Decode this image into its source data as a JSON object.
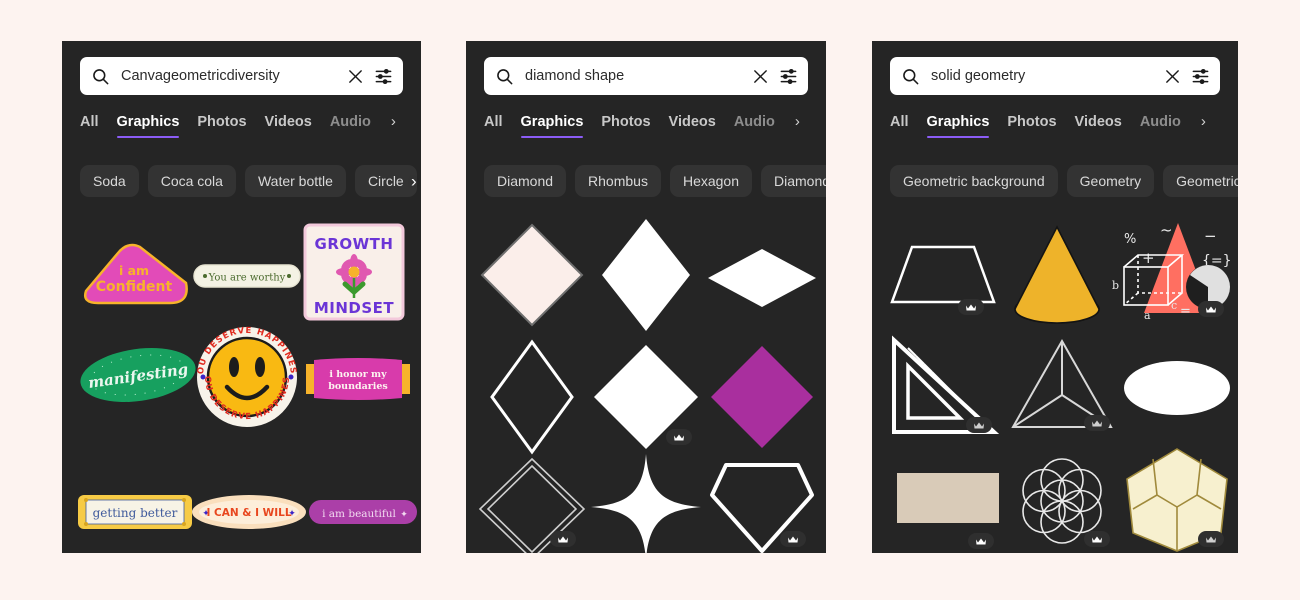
{
  "page": {
    "background_color": "#fdf3f0",
    "panel_background": "#252525",
    "accent_color": "#8b5cf6",
    "panel_count": 3
  },
  "icons": {
    "search": "search-icon",
    "clear": "close-icon",
    "filter": "filter-sliders-icon",
    "chevron_right": "chevron-right-icon",
    "crown": "crown-icon"
  },
  "tabs": [
    {
      "label": "All",
      "active": false,
      "faded": false
    },
    {
      "label": "Graphics",
      "active": true,
      "faded": false
    },
    {
      "label": "Photos",
      "active": false,
      "faded": false
    },
    {
      "label": "Videos",
      "active": false,
      "faded": false
    },
    {
      "label": "Audio",
      "active": false,
      "faded": true
    }
  ],
  "tab_overflow_arrow": "›",
  "panels": [
    {
      "id": "panel-1",
      "search": {
        "value": "Canvageometricdiversity",
        "placeholder": "Search"
      },
      "chips": [
        "Soda",
        "Coca cola",
        "Water bottle",
        "Circle"
      ],
      "chip_overflow_arrow": "›",
      "results_kind": "stickers",
      "items": [
        {
          "name": "i-am-confident-sticker",
          "text": "i am\nConfident",
          "shape": "wedge",
          "fill": "#e24bb8",
          "text_color": "#f7b32b",
          "pro": false
        },
        {
          "name": "you-are-worthy-sticker",
          "text": "You are worthy",
          "shape": "pill",
          "fill": "#f4f2e4",
          "text_color": "#4b6b2e",
          "pro": false
        },
        {
          "name": "growth-mindset-sticker",
          "text": "GROWTH\nMINDSET",
          "shape": "stamp",
          "fill": "#f9efe9",
          "text_color": "#6b35d6",
          "pro": false
        },
        {
          "name": "manifesting-sticker",
          "text": "manifesting",
          "shape": "ellipse",
          "fill": "#17a05f",
          "text_color": "#eaf7ef",
          "pro": false
        },
        {
          "name": "you-deserve-happiness-sticker",
          "text": "YOU DESERVE HAPPINESS",
          "shape": "smiley-badge",
          "fill": "#f9b912",
          "text_color": "#e02b20",
          "pro": false
        },
        {
          "name": "i-honor-my-boundaries-sticker",
          "text": "i honor my\nboundaries",
          "shape": "ticket",
          "fill": "#d83bab",
          "text_color": "#fdf3f0",
          "pro": false
        },
        {
          "name": "getting-better-sticker",
          "text": "getting better",
          "shape": "frame",
          "fill": "#f7cb45",
          "text_color": "#3f5a9c",
          "pro": false
        },
        {
          "name": "i-can-and-i-will-sticker",
          "text": "I CAN & I WILL",
          "shape": "ellipse-glow",
          "fill": "#fadfbd",
          "text_color": "#e8471f",
          "pro": false
        },
        {
          "name": "i-am-beautiful-sticker",
          "text": "i am beautiful",
          "shape": "pill",
          "fill": "#ab3fa8",
          "text_color": "#f2d9f0",
          "pro": false
        }
      ]
    },
    {
      "id": "panel-2",
      "search": {
        "value": "diamond shape",
        "placeholder": "Search"
      },
      "chips": [
        "Diamond",
        "Rhombus",
        "Hexagon",
        "Diamond ring"
      ],
      "chip_overflow_arrow": "›",
      "results_kind": "shapes",
      "items": [
        {
          "name": "outlined-square-diamond",
          "shape": "square-diamond-outline",
          "fill": "#fbeeea",
          "stroke": "#6f6f6f",
          "pro": false
        },
        {
          "name": "tall-rhombus",
          "shape": "tall-rhombus",
          "fill": "#ffffff",
          "stroke": "none",
          "pro": false
        },
        {
          "name": "wide-rhombus",
          "shape": "wide-rhombus",
          "fill": "#ffffff",
          "stroke": "none",
          "pro": false
        },
        {
          "name": "tall-rhombus-outline",
          "shape": "tall-rhombus-outline",
          "fill": "none",
          "stroke": "#ffffff",
          "pro": false
        },
        {
          "name": "white-diamond",
          "shape": "square-diamond",
          "fill": "#ffffff",
          "stroke": "none",
          "pro": true
        },
        {
          "name": "magenta-diamond",
          "shape": "square-diamond",
          "fill": "#a92f9e",
          "stroke": "none",
          "pro": false
        },
        {
          "name": "double-outline-diamond",
          "shape": "double-diamond-outline",
          "fill": "none",
          "stroke": "#cfcfcf",
          "pro": true
        },
        {
          "name": "four-point-sparkle",
          "shape": "sparkle",
          "fill": "#ffffff",
          "stroke": "none",
          "pro": false
        },
        {
          "name": "gem-outline",
          "shape": "gem-outline",
          "fill": "none",
          "stroke": "#ffffff",
          "pro": true
        }
      ]
    },
    {
      "id": "panel-3",
      "search": {
        "value": "solid geometry",
        "placeholder": "Search"
      },
      "chips": [
        "Geometric background",
        "Geometry",
        "Geometric shapes"
      ],
      "chip_overflow_arrow": "›",
      "results_kind": "shapes",
      "items": [
        {
          "name": "trapezoid-outline",
          "shape": "trapezoid-outline",
          "fill": "none",
          "stroke": "#ffffff",
          "pro": true
        },
        {
          "name": "yellow-cone",
          "shape": "cone",
          "fill": "#eeb32a",
          "stroke": "#44a8dd",
          "pro": false
        },
        {
          "name": "math-symbols-illustration",
          "shape": "math-illustration",
          "fill": "#ff6f61",
          "stroke": "#ffffff",
          "pro": true,
          "labels": [
            "%",
            "~",
            "+",
            "−",
            "{=}",
            "a",
            "b",
            "c",
            "="
          ]
        },
        {
          "name": "set-square-ruler",
          "shape": "set-square",
          "fill": "none",
          "stroke": "#ffffff",
          "pro": true
        },
        {
          "name": "tetrahedron-wireframe",
          "shape": "tetrahedron",
          "fill": "none",
          "stroke": "#d8d8d8",
          "pro": true
        },
        {
          "name": "white-ellipse",
          "shape": "ellipse",
          "fill": "#ffffff",
          "stroke": "none",
          "pro": false
        },
        {
          "name": "beige-rectangle",
          "shape": "rectangle",
          "fill": "#d9cbb8",
          "stroke": "none",
          "pro": true
        },
        {
          "name": "flower-of-life",
          "shape": "flower-of-life",
          "fill": "none",
          "stroke": "#e8e8e8",
          "pro": true
        },
        {
          "name": "dodecahedron",
          "shape": "dodecahedron",
          "fill": "#f7f0cf",
          "stroke": "#a08a3c",
          "pro": true
        }
      ]
    }
  ]
}
